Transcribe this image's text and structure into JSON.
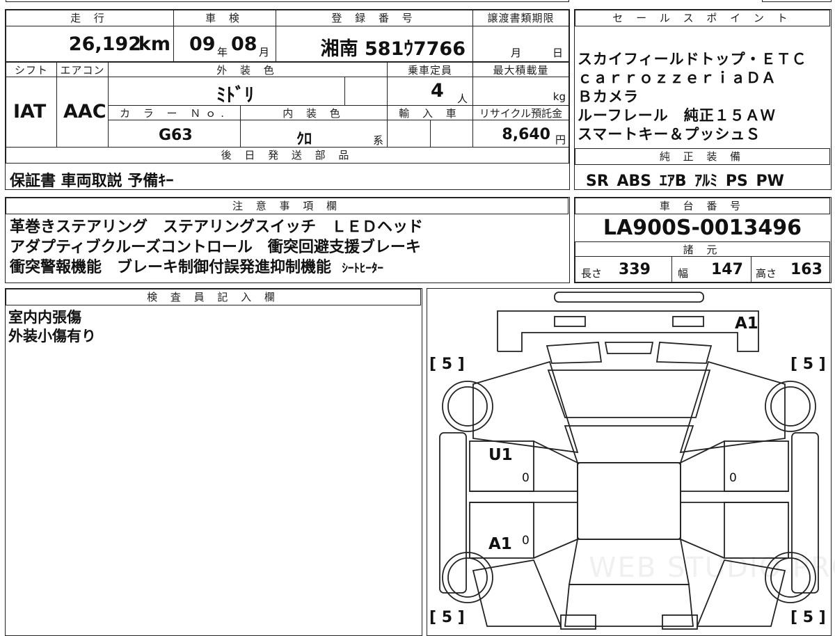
{
  "top": {
    "mileage_label": "走 行",
    "mileage_value": "26,192",
    "mileage_unit": "km",
    "inspection_label": "車 検",
    "inspection_year": "09",
    "inspection_year_unit": "年",
    "inspection_month": "08",
    "inspection_month_unit": "月",
    "registration_label": "登 録 番 号",
    "registration_value": "湘南 581ｳ7766",
    "transfer_label": "譲渡書類期限",
    "transfer_month_unit": "月",
    "transfer_day_unit": "日",
    "sales_label": "セ ー ル ス ポ イ ン ト"
  },
  "sales_points": [
    "スカイフィールドトップ・ＥＴＣ",
    "ｃａｒｒｏｚｚｅｒｉａＤＡ",
    "Ｂカメラ",
    "ルーフレール　純正１５ＡＷ",
    "スマートキー＆プッシュＳ"
  ],
  "spec": {
    "shift_label": "シフト",
    "shift_value": "IAT",
    "aircon_label": "エアコン",
    "aircon_value": "AAC",
    "exterior_color_label": "外 装 色",
    "exterior_color_value": "ﾐﾄﾞﾘ",
    "capacity_label": "乗車定員",
    "capacity_value": "4",
    "capacity_unit": "人",
    "max_load_label": "最大積載量",
    "max_load_unit": "kg",
    "color_no_label": "カ ラ ー Ｎｏ.",
    "color_no_value": "G63",
    "interior_color_label": "内 装 色",
    "interior_color_value": "ｸﾛ",
    "interior_color_suffix": "系",
    "import_label": "輸 入 車",
    "recycle_label": "リサイクル預託金",
    "recycle_value": "8,640",
    "recycle_unit": "円"
  },
  "parts": {
    "label": "後 日 発 送 部 品",
    "value": "保証書 車両取説 予備ｷｰ"
  },
  "genuine": {
    "label": "純 正 装 備",
    "value": "SR ABS ｴｱB ｱﾙﾐ PS PW"
  },
  "notes": {
    "label": "注 意 事 項 欄",
    "lines": [
      "革巻きステアリング　ステアリングスイッチ　ＬＥＤヘッド",
      "アダプティブクルーズコントロール　衝突回避支援ブレーキ",
      "衝突警報機能　ブレーキ制御付誤発進抑制機能"
    ],
    "extra": "ｼｰﾄﾋｰﾀｰ"
  },
  "chassis": {
    "label": "車 台 番 号",
    "value": "LA900S-0013496"
  },
  "dimensions": {
    "label": "諸 元",
    "length_label": "長さ",
    "length_value": "339",
    "width_label": "幅",
    "width_value": "147",
    "height_label": "高さ",
    "height_value": "163"
  },
  "inspector": {
    "label": "検 査 員 記 入 欄",
    "lines": [
      "室内内張傷",
      "外装小傷有り"
    ]
  },
  "diagram": {
    "tire_front_left": "[ 5 ]",
    "tire_front_right": "[ 5 ]",
    "tire_rear_left": "[ 5 ]",
    "tire_rear_right": "[ 5 ]",
    "mark_front": "A1",
    "mark_left_front_door": "U1",
    "mark_left_rear_door": "A1",
    "zero_marks": [
      "0",
      "0",
      "0"
    ],
    "watermark": "WEB STUDIO PRO"
  }
}
